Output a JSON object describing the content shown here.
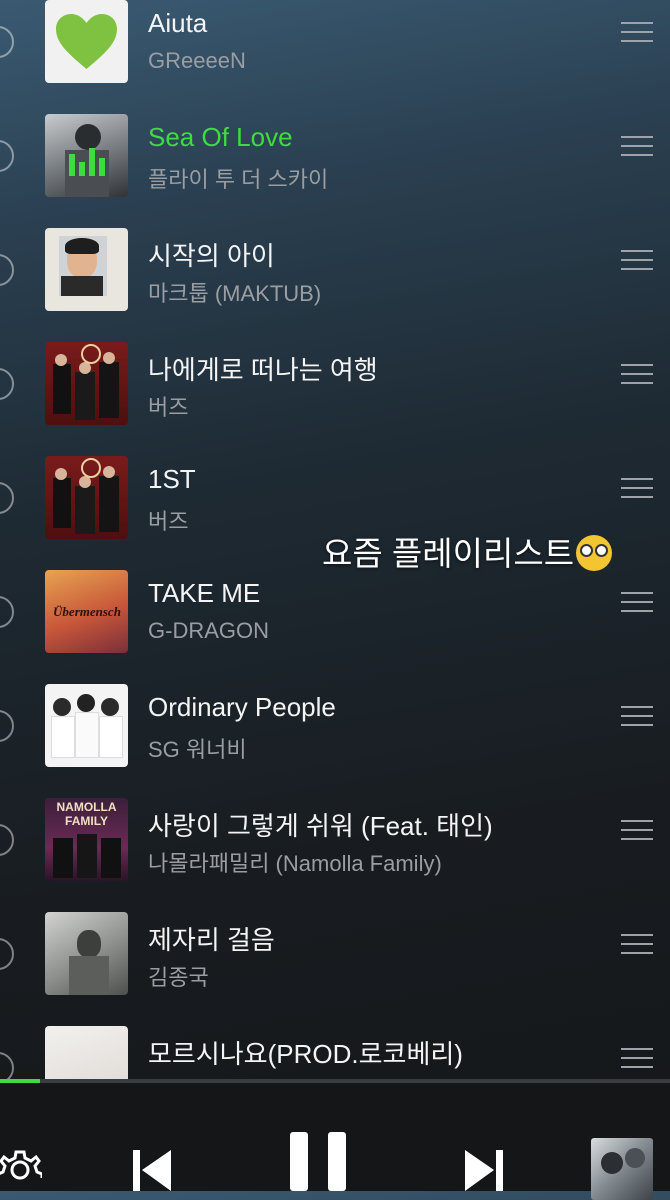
{
  "playlist": {
    "items": [
      {
        "title": "Aiuta",
        "artist": "GReeeeN",
        "playing": false,
        "art": "green-heart"
      },
      {
        "title": "Sea Of Love",
        "artist": "플라이 투 더 스카이",
        "playing": true,
        "art": "gray-photo"
      },
      {
        "title": "시작의 아이",
        "artist": "마크툽 (MAKTUB)",
        "playing": false,
        "art": "child-photo"
      },
      {
        "title": "나에게로 떠나는 여행",
        "artist": "버즈",
        "playing": false,
        "art": "red-group"
      },
      {
        "title": "1ST",
        "artist": "버즈",
        "playing": false,
        "art": "red-group"
      },
      {
        "title": "TAKE ME",
        "artist": "G-DRAGON",
        "playing": false,
        "art": "ubermensch"
      },
      {
        "title": "Ordinary People",
        "artist": "SG 워너비",
        "playing": false,
        "art": "white-trio"
      },
      {
        "title": "사랑이 그렇게 쉬워 (Feat. 태인)",
        "artist": "나몰라패밀리 (Namolla Family)",
        "playing": false,
        "art": "namolla"
      },
      {
        "title": "제자리 걸음",
        "artist": "김종국",
        "playing": false,
        "art": "bw-photo"
      },
      {
        "title": "모르시나요(PROD.로코베리)",
        "artist": "",
        "playing": false,
        "art": "light"
      }
    ]
  },
  "overlay": {
    "caption": "요즘 플레이리스트",
    "emoji": "nerd-face-icon"
  },
  "player": {
    "progress": 0.06,
    "accent": "#3ddc3f"
  },
  "icons": {
    "settings": "gear-icon",
    "previous": "skip-previous-icon",
    "pause": "pause-icon",
    "next": "skip-next-icon",
    "drag": "drag-handle-icon"
  }
}
